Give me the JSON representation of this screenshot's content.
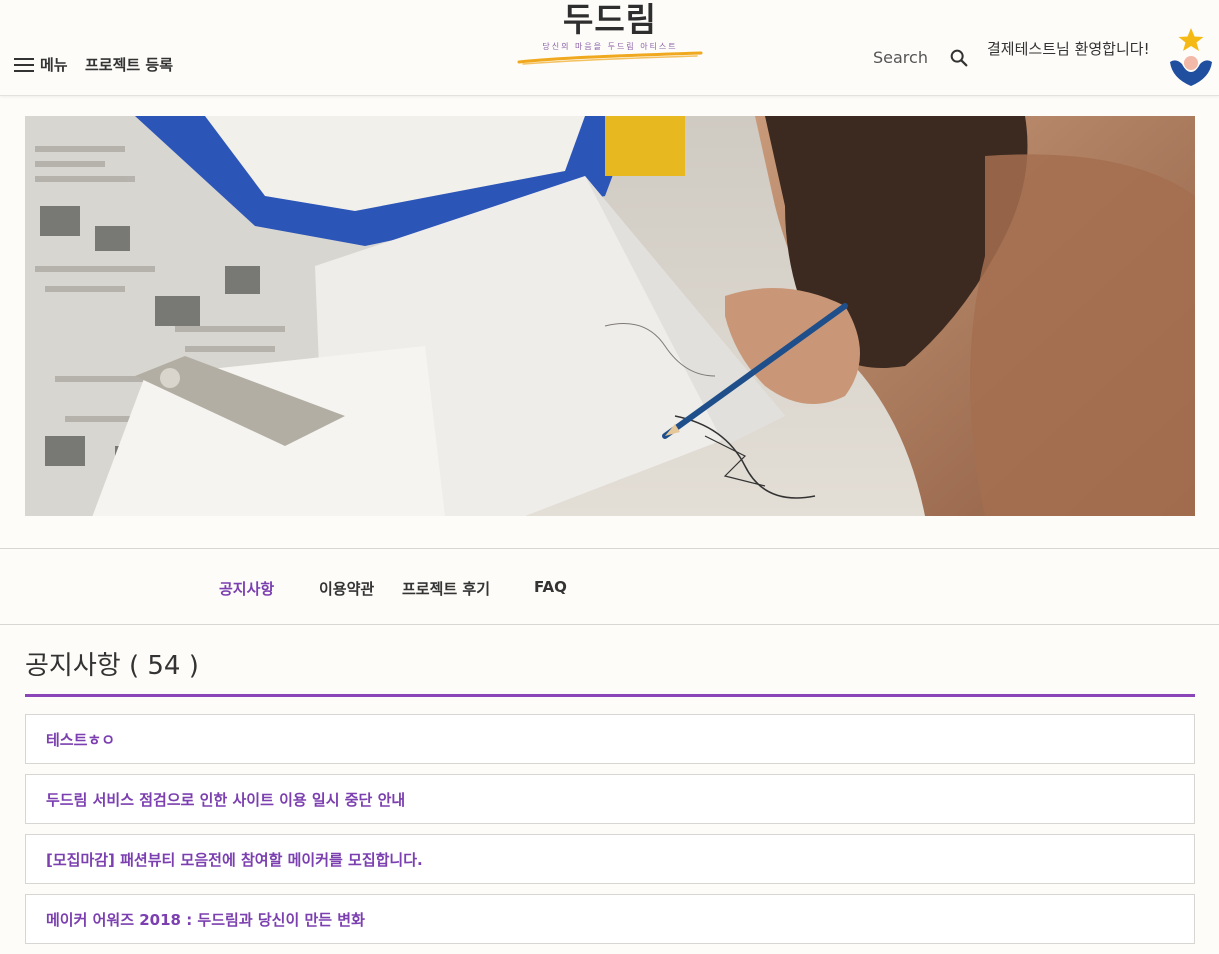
{
  "header": {
    "menu_label": "메뉴",
    "register_label": "프로젝트 등록",
    "logo_title": "두드림",
    "logo_subtitle": "당신의 마음을 두드림 아티스트",
    "search_label": "Search",
    "welcome_text": "결제테스트님 환영합니다!"
  },
  "tabs": [
    {
      "label": "공지사항",
      "active": true
    },
    {
      "label": "이용약관",
      "active": false
    },
    {
      "label": "프로젝트 후기",
      "active": false
    },
    {
      "label": "FAQ",
      "active": false
    }
  ],
  "notices": {
    "title": "공지사항 ( 54 )",
    "items": [
      {
        "title": "테스트ㅎㅇ"
      },
      {
        "title": "두드림 서비스 점검으로 인한 사이트 이용 일시 중단 안내"
      },
      {
        "title": "[모집마감] 패션뷰티 모음전에 참여할 메이커를 모집합니다."
      },
      {
        "title": "메이커 어워즈 2018 : 두드림과 당신이 만든 변화"
      }
    ]
  },
  "colors": {
    "accent": "#7b3fb0",
    "accent_line": "#8a45b8",
    "logo_stroke": "#f0a81e",
    "background": "#fdfcf9"
  },
  "icons": {
    "menu": "hamburger-icon",
    "search": "search-icon",
    "avatar": "user-star-avatar"
  }
}
